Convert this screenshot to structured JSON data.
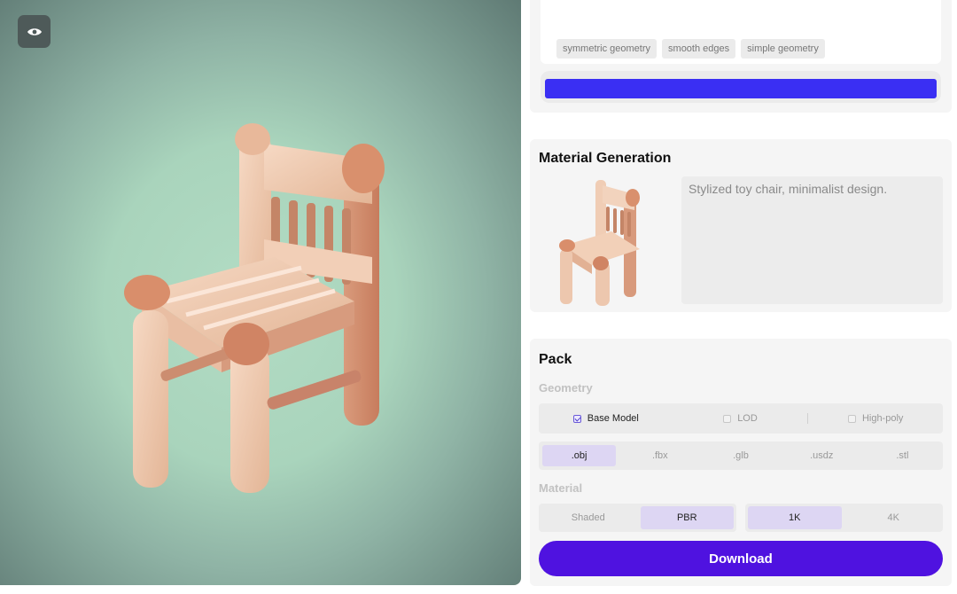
{
  "viewer": {
    "toggle_icon": "eye-icon"
  },
  "prompt": {
    "tags": [
      "symmetric geometry",
      "smooth edges",
      "simple geometry"
    ],
    "generate_color": "#3a2ff3"
  },
  "material_generation": {
    "title": "Material Generation",
    "prompt_text": "Stylized toy chair, minimalist design."
  },
  "pack": {
    "title": "Pack",
    "geometry_label": "Geometry",
    "geometry_options": [
      {
        "label": "Base Model",
        "checked": true
      },
      {
        "label": "LOD",
        "checked": false
      },
      {
        "label": "High-poly",
        "checked": false
      }
    ],
    "formats": [
      ".obj",
      ".fbx",
      ".glb",
      ".usdz",
      ".stl"
    ],
    "selected_format": ".obj",
    "material_label": "Material",
    "shading": [
      "Shaded",
      "PBR"
    ],
    "selected_shading": "PBR",
    "resolution": [
      "1K",
      "4K"
    ],
    "selected_resolution": "1K",
    "download_label": "Download",
    "accent_color": "#4f12e0"
  }
}
